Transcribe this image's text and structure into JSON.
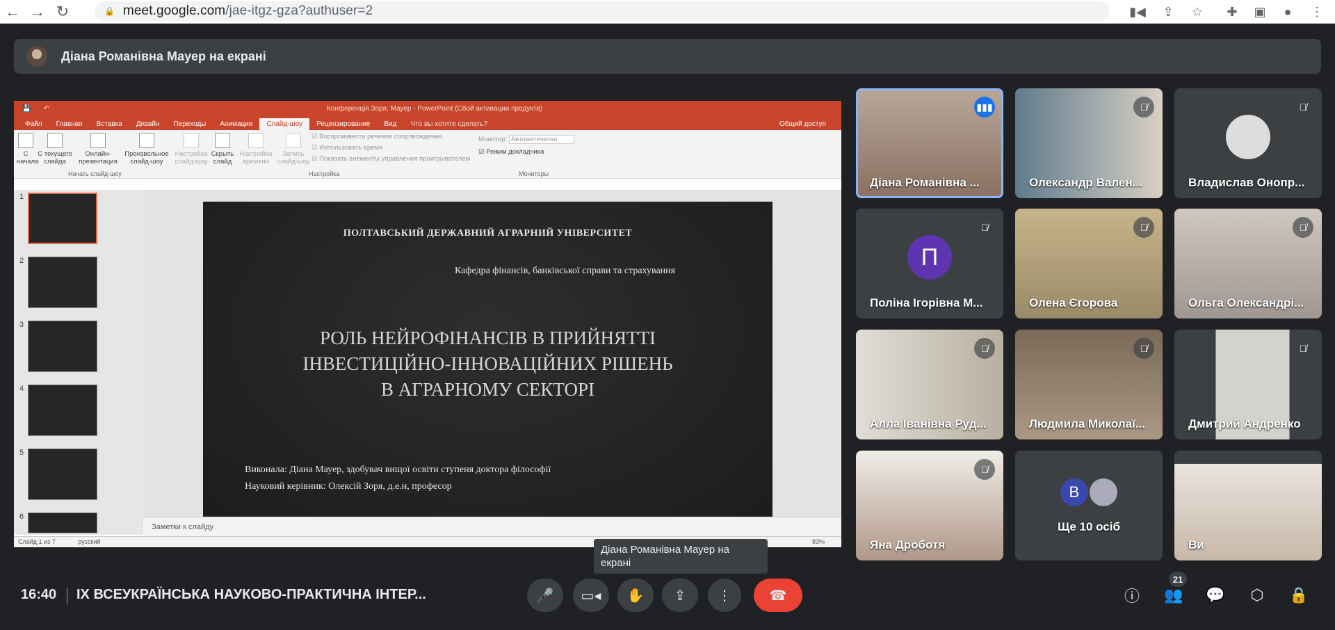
{
  "browser": {
    "url_domain": "meet.google.com",
    "url_path": "/jae-itgz-gza?authuser=2",
    "icons": [
      "back-icon",
      "forward-icon",
      "reload-icon",
      "lock-icon",
      "camera-icon",
      "share-icon",
      "star-icon",
      "puzzle-icon",
      "sidebar-icon",
      "profile-icon",
      "kebab-icon"
    ]
  },
  "banner": {
    "text": "Діана Романівна Мауер на екрані"
  },
  "ppt": {
    "window_title": "Конференція Зоря, Мауер - PowerPoint (Сбой активации продукта)",
    "tabs": [
      "Файл",
      "Главная",
      "Вставка",
      "Дизайн",
      "Переходы",
      "Анимация",
      "Слайд-шоу",
      "Рецензирование",
      "Вид",
      "Что вы хотите сделать?"
    ],
    "share": "Общий доступ",
    "ribbon": {
      "b1": "С\nначала",
      "b2": "С текущего\nслайда",
      "b3": "Онлайн-\nпрезентация",
      "b4": "Произвольное\nслайд-шоу",
      "group1": "Начать слайд-шоу",
      "b5": "Настройка\nслайд-шоу",
      "b6": "Скрыть\nслайд",
      "b7": "Настройка\nвремени",
      "b8": "Запись\nслайд-шоу",
      "c1": "Воспроизвести речевое сопровождение",
      "c2": "Использовать время",
      "c3": "Показать элементы управления проигрывателем",
      "group2": "Настройка",
      "monitor_label": "Монитор:",
      "monitor_value": "Автоматически",
      "presenter": "Режим докладчика",
      "group3": "Мониторы"
    },
    "thumbs": [
      "1",
      "2",
      "3",
      "4",
      "5",
      "6"
    ],
    "slide": {
      "university": "ПОЛТАВСЬКИЙ ДЕРЖАВНИЙ АГРАРНИЙ УНІВЕРСИТЕТ",
      "department": "Кафедра фінансів, банківської справи та страхування",
      "title_l1": "РОЛЬ НЕЙРОФІНАНСІВ В ПРИЙНЯТТІ",
      "title_l2": "ІНВЕСТИЦІЙНО-ІННОВАЦІЙНИХ РІШЕНЬ",
      "title_l3": "В АГРАРНОМУ СЕКТОРІ",
      "author": "Виконала: Діана Мауер, здобувач вищої освіти ступеня доктора філософії",
      "supervisor": "Науковий керівник: Олексій Зоря, д.е.н, професор"
    },
    "notes": "Заметки к слайду",
    "status_slide": "Слайд 1 из 7",
    "status_lang": "русский",
    "zoom": "83%"
  },
  "participants": [
    {
      "name": "Діана Романівна ...",
      "speaking": true
    },
    {
      "name": "Олександр Вален..."
    },
    {
      "name": "Владислав Онопр..."
    },
    {
      "name": "Поліна Ігорівна М...",
      "initial": "П",
      "color": "#5e35b1"
    },
    {
      "name": "Олена Єгорова"
    },
    {
      "name": "Ольга Олександрі..."
    },
    {
      "name": "Алла Іванівна Руд..."
    },
    {
      "name": "Людмила Миколаї..."
    },
    {
      "name": "Дмитрий Андренко"
    },
    {
      "name": "Яна Дроботя"
    },
    {
      "name": "Ще 10 осіб",
      "initial": "В",
      "color": "#3949ab"
    },
    {
      "name": "Ви"
    }
  ],
  "bottom": {
    "time": "16:40",
    "meeting_title": "IX ВСЕУКРАЇНСЬКА НАУКОВО-ПРАКТИЧНА ІНТЕР...",
    "people_count": "21",
    "tooltip": "Діана Романівна Мауер на екрані"
  }
}
